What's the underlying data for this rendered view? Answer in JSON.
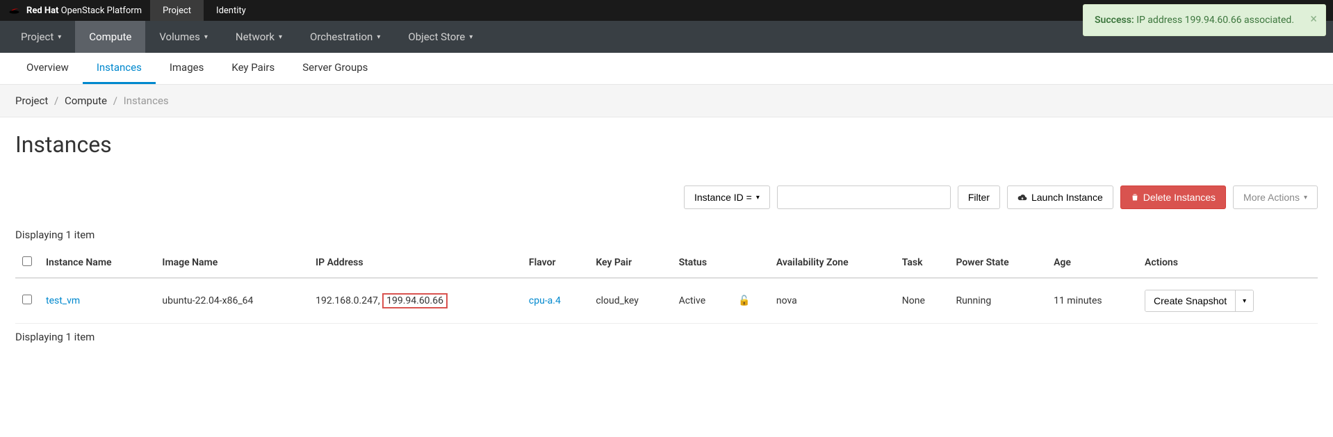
{
  "brand": {
    "strong": "Red Hat",
    "rest": "OpenStack Platform"
  },
  "topTabs": [
    {
      "label": "Project",
      "active": true
    },
    {
      "label": "Identity",
      "active": false
    }
  ],
  "mainNav": [
    {
      "label": "Project",
      "caret": true,
      "active": false
    },
    {
      "label": "Compute",
      "caret": false,
      "active": true
    },
    {
      "label": "Volumes",
      "caret": true,
      "active": false
    },
    {
      "label": "Network",
      "caret": true,
      "active": false
    },
    {
      "label": "Orchestration",
      "caret": true,
      "active": false
    },
    {
      "label": "Object Store",
      "caret": true,
      "active": false
    }
  ],
  "subNav": [
    {
      "label": "Overview",
      "active": false
    },
    {
      "label": "Instances",
      "active": true
    },
    {
      "label": "Images",
      "active": false
    },
    {
      "label": "Key Pairs",
      "active": false
    },
    {
      "label": "Server Groups",
      "active": false
    }
  ],
  "breadcrumb": {
    "a": "Project",
    "b": "Compute",
    "c": "Instances"
  },
  "page": {
    "title": "Instances"
  },
  "toolbar": {
    "filterField": "Instance ID =",
    "filterBtn": "Filter",
    "launch": "Launch Instance",
    "delete": "Delete Instances",
    "more": "More Actions"
  },
  "table": {
    "displayingTop": "Displaying 1 item",
    "displayingBottom": "Displaying 1 item",
    "headers": {
      "name": "Instance Name",
      "image": "Image Name",
      "ip": "IP Address",
      "flavor": "Flavor",
      "keypair": "Key Pair",
      "status": "Status",
      "az": "Availability Zone",
      "task": "Task",
      "power": "Power State",
      "age": "Age",
      "actions": "Actions"
    },
    "rows": [
      {
        "name": "test_vm",
        "image": "ubuntu-22.04-x86_64",
        "ip1": "192.168.0.247,",
        "ip2": "199.94.60.66",
        "flavor": "cpu-a.4",
        "keypair": "cloud_key",
        "status": "Active",
        "az": "nova",
        "task": "None",
        "power": "Running",
        "age": "11 minutes",
        "action": "Create Snapshot"
      }
    ]
  },
  "toast": {
    "strong": "Success:",
    "msg": " IP address 199.94.60.66 associated."
  }
}
